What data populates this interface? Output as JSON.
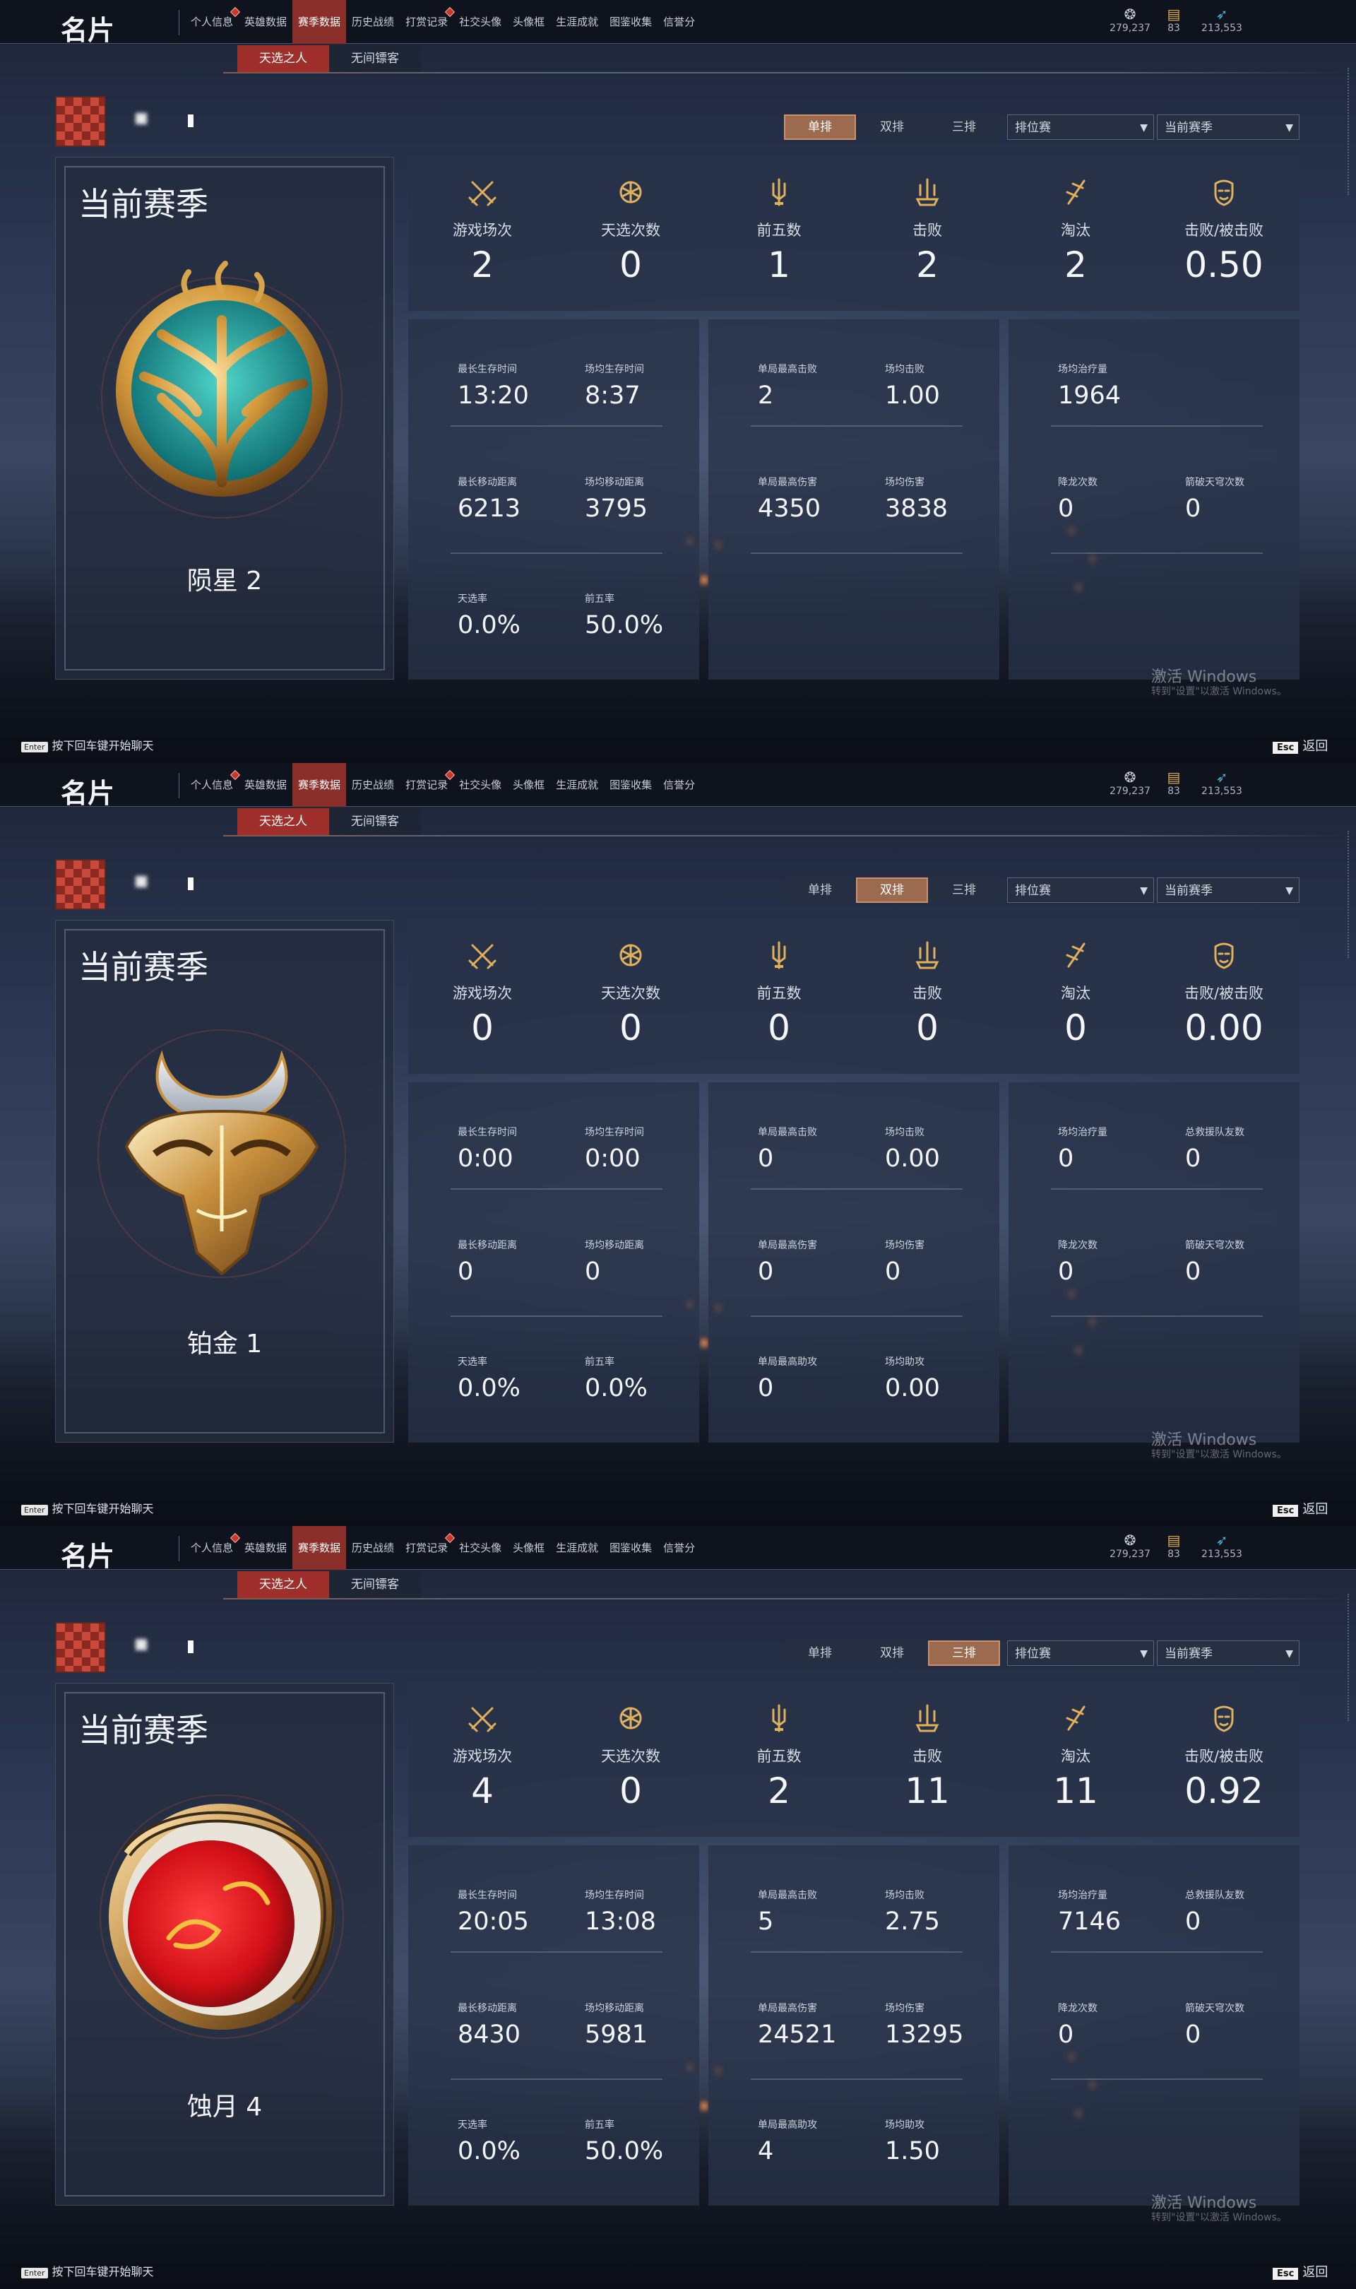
{
  "topbar": {
    "title": "名片",
    "tabs": [
      "个人信息",
      "英雄数据",
      "赛季数据",
      "历史战绩",
      "打赏记录",
      "社交头像",
      "头像框",
      "生涯成就",
      "图鉴收集",
      "信誉分"
    ],
    "active_tab": 2,
    "badge_tabs": [
      0,
      4
    ],
    "resources": [
      {
        "icon": "coin-icon",
        "value": "279,237"
      },
      {
        "icon": "ticket-icon",
        "value": "83"
      },
      {
        "icon": "feather-icon",
        "value": "213,553"
      }
    ]
  },
  "subtabs": [
    "天选之人",
    "无间镖客"
  ],
  "filters": {
    "rank_type": "排位赛",
    "season": "当前赛季"
  },
  "mode_labels": [
    "单排",
    "双排",
    "三排"
  ],
  "watermark": {
    "line1": "激活 Windows",
    "line2": "转到\"设置\"以激活 Windows。"
  },
  "footer": {
    "enter_key": "Enter",
    "enter_text": "按下回车键开始聊天",
    "esc_key": "Esc",
    "esc_text": "返回"
  },
  "top_labels": [
    "游戏场次",
    "天选次数",
    "前五数",
    "击败",
    "淘汰",
    "击败/被击败"
  ],
  "panels": [
    {
      "active_mode": 0,
      "season_label": "当前赛季",
      "rank_name": "陨星 2",
      "emblem": "tree-emblem",
      "top_values": [
        "2",
        "0",
        "1",
        "2",
        "2",
        "0.50"
      ],
      "group1": [
        {
          "label": "最长生存时间",
          "value": "13:20"
        },
        {
          "label": "场均生存时间",
          "value": "8:37"
        },
        {
          "label": "最长移动距离",
          "value": "6213"
        },
        {
          "label": "场均移动距离",
          "value": "3795"
        },
        {
          "label": "天选率",
          "value": "0.0%"
        },
        {
          "label": "前五率",
          "value": "50.0%"
        }
      ],
      "group2": [
        {
          "label": "单局最高击败",
          "value": "2"
        },
        {
          "label": "场均击败",
          "value": "1.00"
        },
        {
          "label": "单局最高伤害",
          "value": "4350"
        },
        {
          "label": "场均伤害",
          "value": "3838"
        }
      ],
      "group3": [
        {
          "label": "场均治疗量",
          "value": "1964"
        },
        {
          "label": "降龙次数",
          "value": "0"
        },
        {
          "label": "箭破天穹次数",
          "value": "0"
        }
      ]
    },
    {
      "active_mode": 1,
      "season_label": "当前赛季",
      "rank_name": "铂金 1",
      "emblem": "ox-mask-emblem",
      "top_values": [
        "0",
        "0",
        "0",
        "0",
        "0",
        "0.00"
      ],
      "group1": [
        {
          "label": "最长生存时间",
          "value": "0:00"
        },
        {
          "label": "场均生存时间",
          "value": "0:00"
        },
        {
          "label": "最长移动距离",
          "value": "0"
        },
        {
          "label": "场均移动距离",
          "value": "0"
        },
        {
          "label": "天选率",
          "value": "0.0%"
        },
        {
          "label": "前五率",
          "value": "0.0%"
        }
      ],
      "group2": [
        {
          "label": "单局最高击败",
          "value": "0"
        },
        {
          "label": "场均击败",
          "value": "0.00"
        },
        {
          "label": "单局最高伤害",
          "value": "0"
        },
        {
          "label": "场均伤害",
          "value": "0"
        },
        {
          "label": "单局最高助攻",
          "value": "0"
        },
        {
          "label": "场均助攻",
          "value": "0.00"
        }
      ],
      "group3": [
        {
          "label": "场均治疗量",
          "value": "0"
        },
        {
          "label": "总救援队友数",
          "value": "0"
        },
        {
          "label": "降龙次数",
          "value": "0"
        },
        {
          "label": "箭破天穹次数",
          "value": "0"
        }
      ]
    },
    {
      "active_mode": 2,
      "season_label": "当前赛季",
      "rank_name": "蚀月 4",
      "emblem": "dragon-moon-emblem",
      "top_values": [
        "4",
        "0",
        "2",
        "11",
        "11",
        "0.92"
      ],
      "group1": [
        {
          "label": "最长生存时间",
          "value": "20:05"
        },
        {
          "label": "场均生存时间",
          "value": "13:08"
        },
        {
          "label": "最长移动距离",
          "value": "8430"
        },
        {
          "label": "场均移动距离",
          "value": "5981"
        },
        {
          "label": "天选率",
          "value": "0.0%"
        },
        {
          "label": "前五率",
          "value": "50.0%"
        }
      ],
      "group2": [
        {
          "label": "单局最高击败",
          "value": "5"
        },
        {
          "label": "场均击败",
          "value": "2.75"
        },
        {
          "label": "单局最高伤害",
          "value": "24521"
        },
        {
          "label": "场均伤害",
          "value": "13295"
        },
        {
          "label": "单局最高助攻",
          "value": "4"
        },
        {
          "label": "场均助攻",
          "value": "1.50"
        }
      ],
      "group3": [
        {
          "label": "场均治疗量",
          "value": "7146"
        },
        {
          "label": "总救援队友数",
          "value": "0"
        },
        {
          "label": "降龙次数",
          "value": "0"
        },
        {
          "label": "箭破天穹次数",
          "value": "0"
        }
      ]
    }
  ]
}
